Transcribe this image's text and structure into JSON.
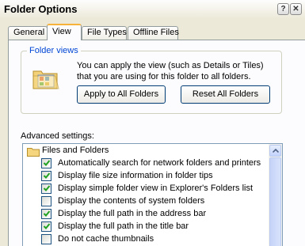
{
  "window": {
    "title": "Folder Options",
    "help_glyph": "?",
    "close_glyph": "✕"
  },
  "tabs": [
    {
      "label": "General",
      "active": false
    },
    {
      "label": "View",
      "active": true
    },
    {
      "label": "File Types",
      "active": false
    },
    {
      "label": "Offline Files",
      "active": false
    }
  ],
  "folder_views": {
    "group_label": "Folder views",
    "description": "You can apply the view (such as Details or Tiles) that you are using for this folder to all folders.",
    "apply_label": "Apply to All Folders",
    "reset_label": "Reset All Folders"
  },
  "advanced": {
    "label": "Advanced settings:",
    "items": [
      {
        "type": "folder",
        "text": "Files and Folders"
      },
      {
        "type": "checkbox",
        "text": "Automatically search for network folders and printers",
        "checked": true
      },
      {
        "type": "checkbox",
        "text": "Display file size information in folder tips",
        "checked": true
      },
      {
        "type": "checkbox",
        "text": "Display simple folder view in Explorer's Folders list",
        "checked": true
      },
      {
        "type": "checkbox",
        "text": "Display the contents of system folders",
        "checked": false
      },
      {
        "type": "checkbox",
        "text": "Display the full path in the address bar",
        "checked": true
      },
      {
        "type": "checkbox",
        "text": "Display the full path in the title bar",
        "checked": true
      },
      {
        "type": "checkbox",
        "text": "Do not cache thumbnails",
        "checked": false
      }
    ]
  },
  "colors": {
    "accent": "#0046d5",
    "check": "#21a121",
    "tab_highlight": "#f7b23a"
  }
}
